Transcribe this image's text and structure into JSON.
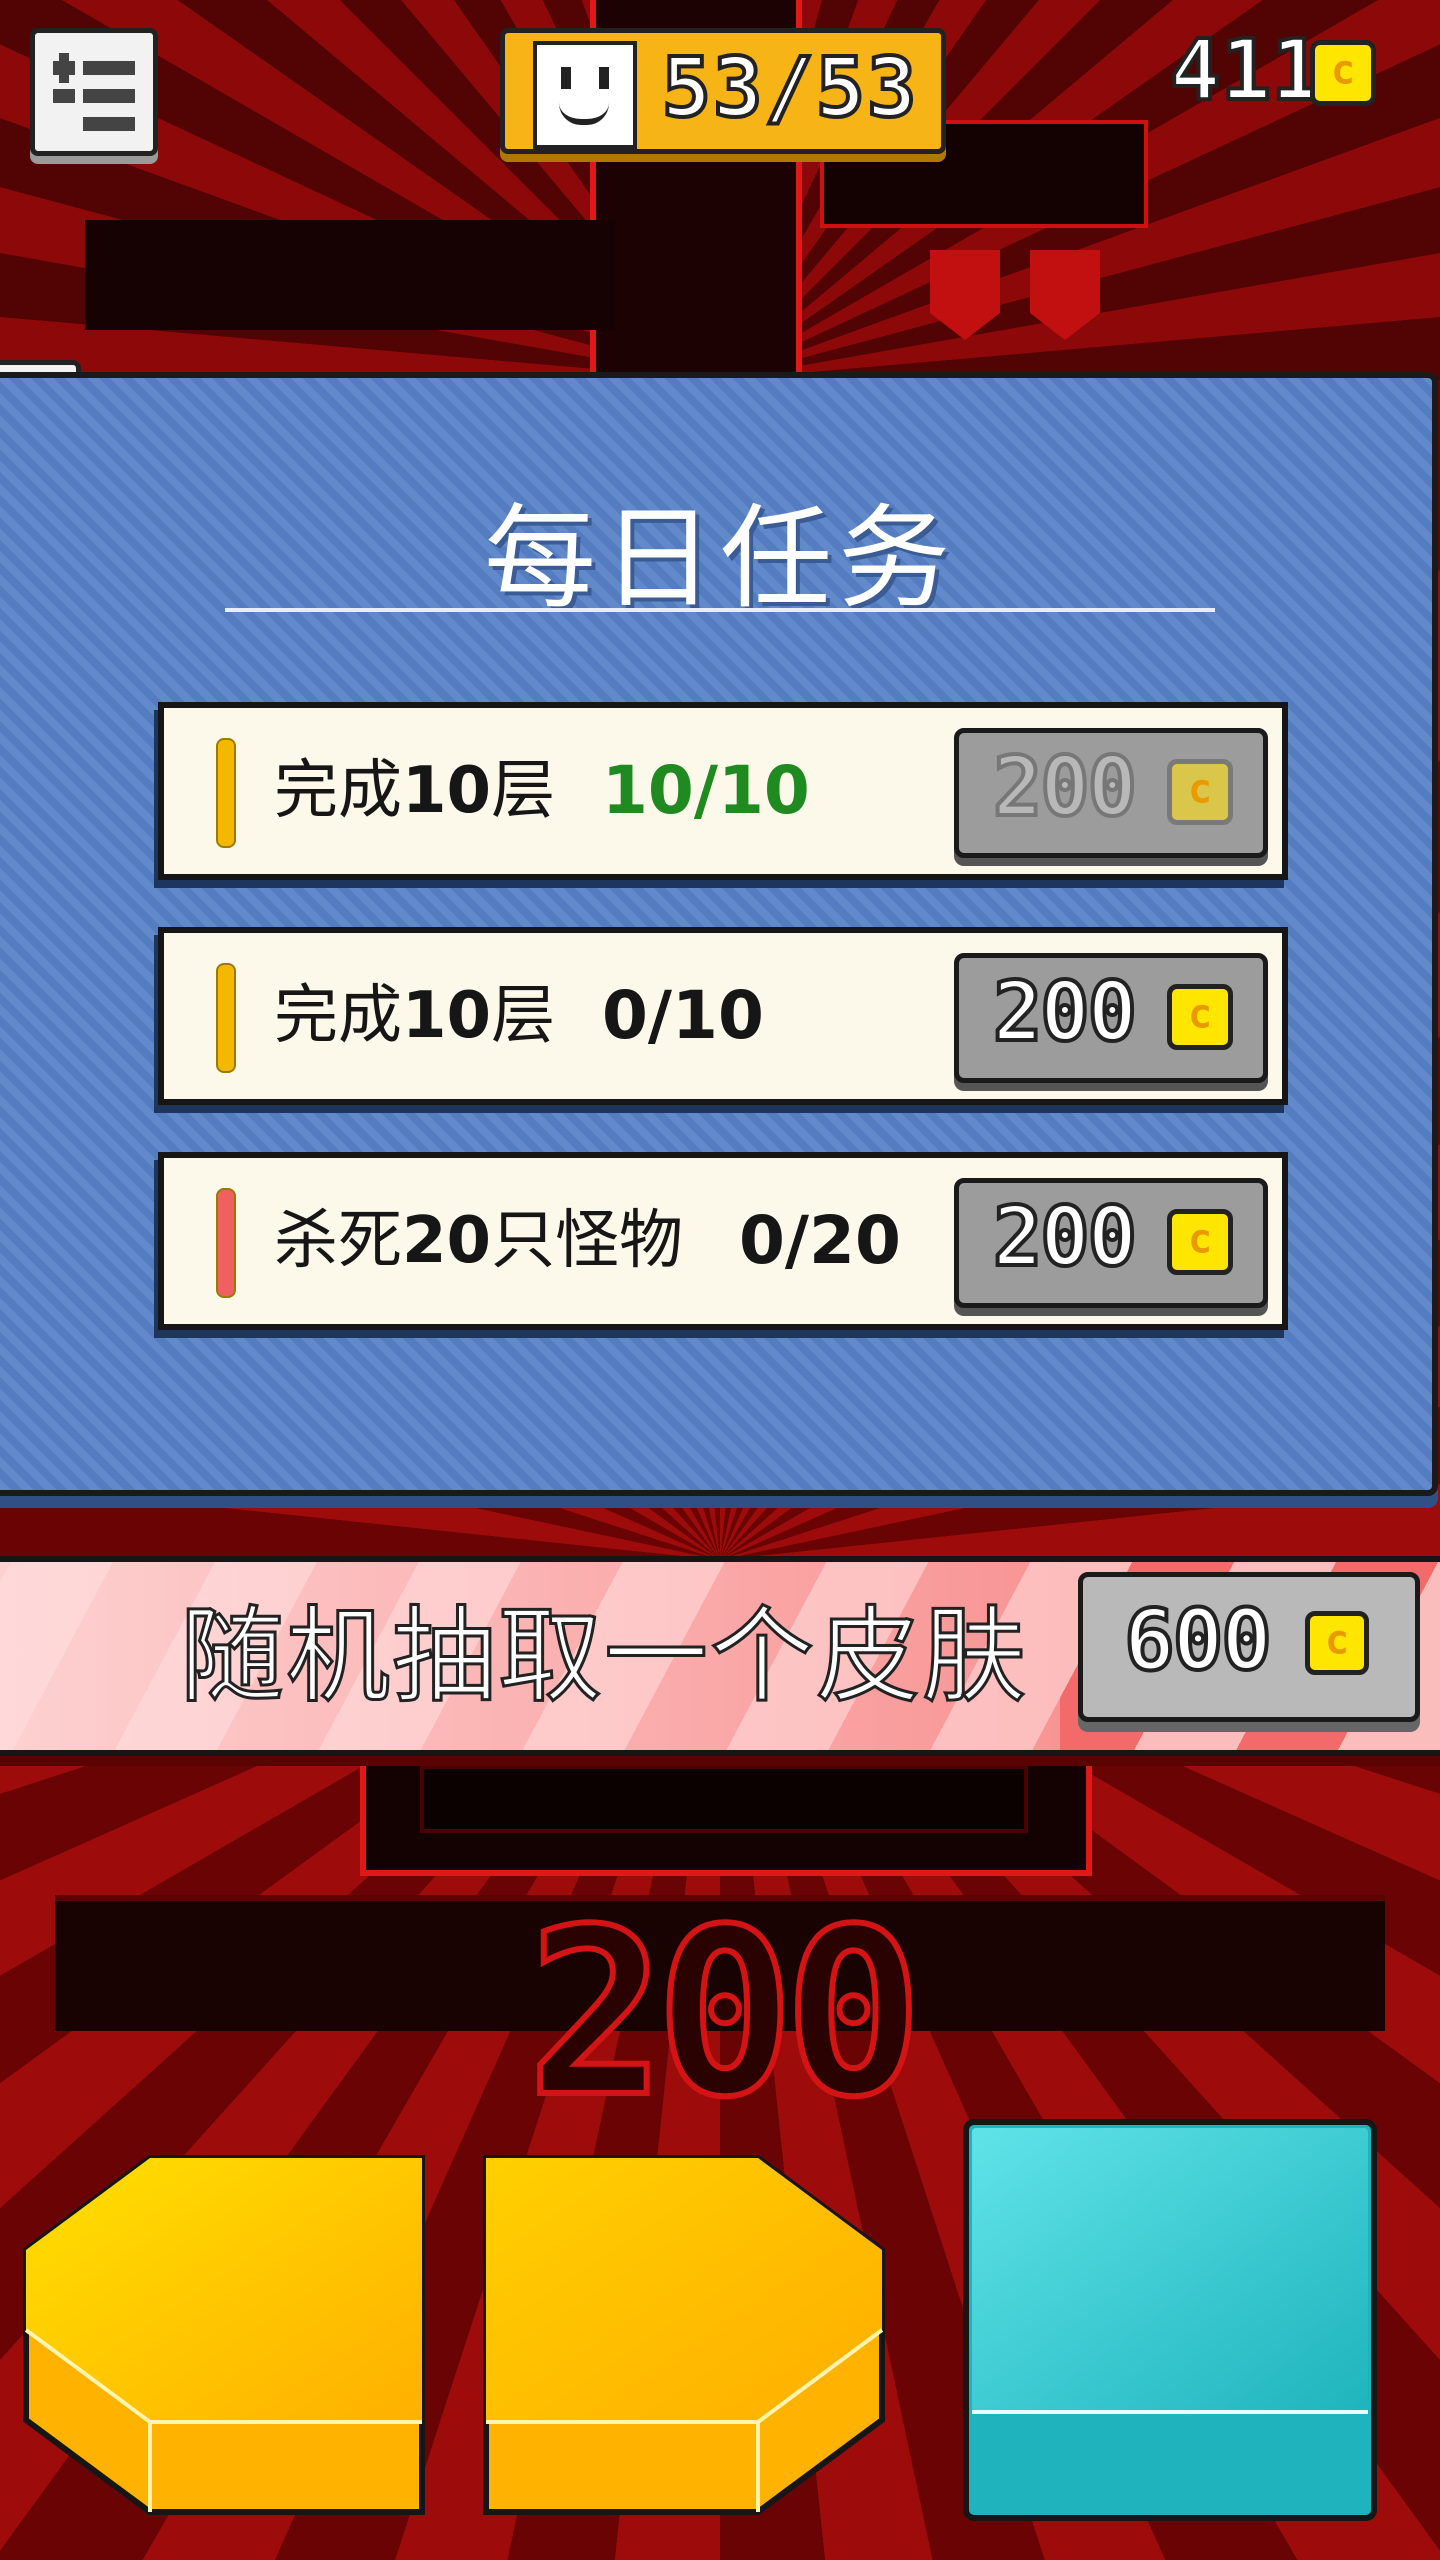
{
  "hud": {
    "menu_icon": "menu-list-icon",
    "level_progress": "53/53",
    "coins": "411",
    "coin_icon": "coin-icon"
  },
  "daily_tasks": {
    "title": "每日任务",
    "tasks": [
      {
        "label_pre": "完成",
        "label_num": "10",
        "label_post": "层",
        "progress": "10/10",
        "progress_color": "#1f8a1f",
        "indicator_color": "#f5b800",
        "reward": "200",
        "reward_state": "disabled"
      },
      {
        "label_pre": "完成",
        "label_num": "10",
        "label_post": "层",
        "progress": "0/10",
        "progress_color": "#161616",
        "indicator_color": "#f5b800",
        "reward": "200",
        "reward_state": "enabled"
      },
      {
        "label_pre": "杀死",
        "label_num": "20",
        "label_post": "只怪物",
        "progress": "0/20",
        "progress_color": "#161616",
        "indicator_color": "#f06060",
        "reward": "200",
        "reward_state": "enabled"
      }
    ]
  },
  "random_skin": {
    "label": "随机抽取一个皮肤",
    "price": "600"
  },
  "background_score": "200",
  "controls": {
    "left_icon": "left-arrow-icon",
    "right_icon": "right-arrow-icon",
    "action_icon": "jump-block-icon"
  },
  "colors": {
    "panel_blue": "#5681c6",
    "hud_yellow": "#f7b417",
    "coin_yellow": "#ffe600",
    "arrow_yellow": "#ffc400",
    "action_cyan": "#3fd3d8",
    "background_red": "#9e0b0b"
  }
}
